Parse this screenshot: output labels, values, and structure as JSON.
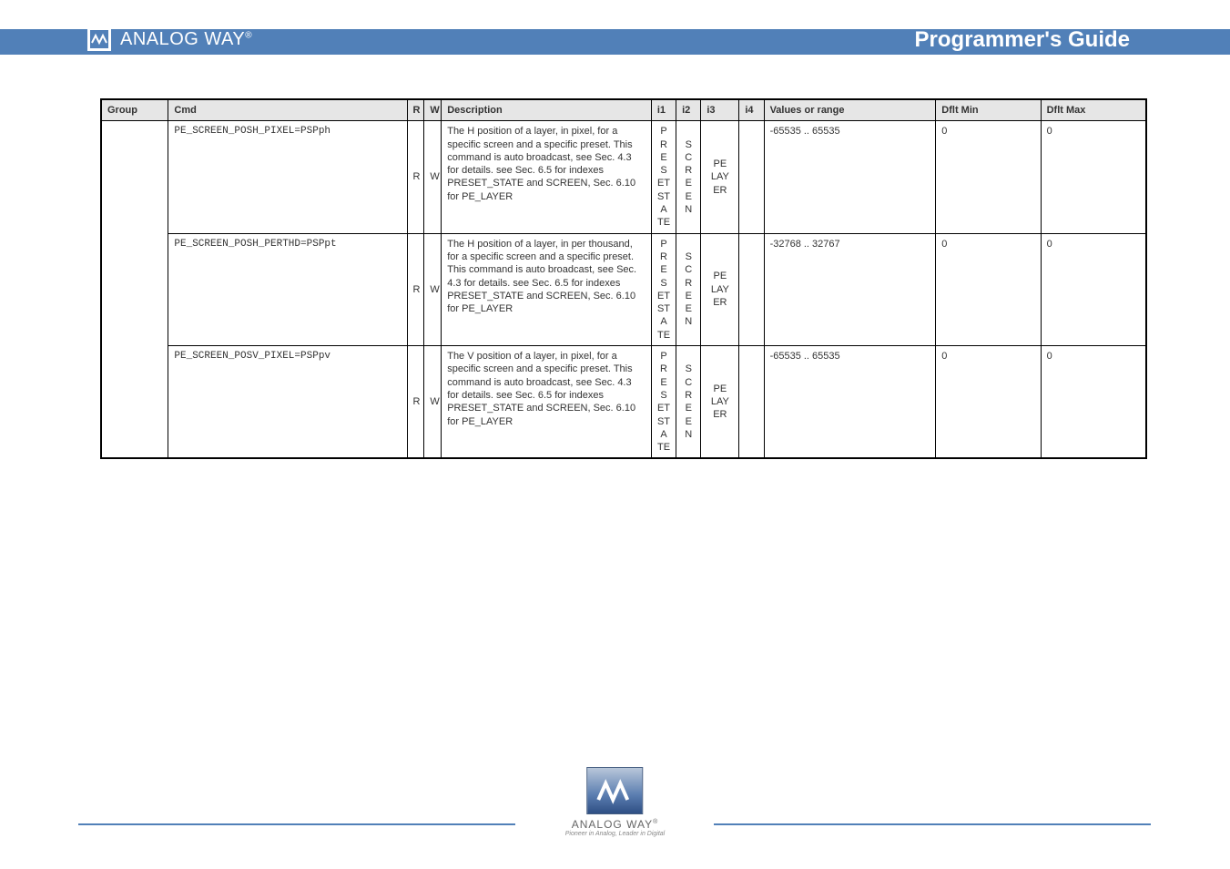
{
  "header": {
    "brand": "ANALOG WAY",
    "reg": "®",
    "title": "Programmer's Guide"
  },
  "table": {
    "headers": {
      "group": "Group",
      "cmd": "Cmd",
      "r": "R",
      "w": "W",
      "desc": "Description",
      "i1": "i1",
      "i2": "i2",
      "i3": "i3",
      "i4": "i4",
      "values": "Values or range",
      "min": "Dflt Min",
      "max": "Dflt Max"
    },
    "groupLabel": "",
    "rows": [
      {
        "cmd": "PE_SCREEN_POSH_PIXEL=PSPph",
        "r": "R",
        "w": "W",
        "desc": "The H position of a layer, in pixel, for a specific screen and a specific preset. This command is auto broadcast, see Sec. 4.3 for details. see Sec. 6.5 for indexes PRESET_STATE and SCREEN, Sec. 6.10 for PE_LAYER",
        "i1": "",
        "i2": "",
        "i3": "PE LAY ER",
        "i4": "",
        "values": "-65535 .. 65535",
        "min": "0",
        "max": "0"
      },
      {
        "cmd": "PE_SCREEN_POSH_PERTHD=PSPpt",
        "r": "R",
        "w": "W",
        "desc": "The H position of a layer, in per thousand, for a specific screen and a specific preset. This command is auto broadcast, see Sec. 4.3 for details. see Sec. 6.5 for indexes PRESET_STATE and SCREEN, Sec. 6.10 for PE_LAYER",
        "i1": "",
        "i2": "",
        "i3": "PE LAY ER",
        "i4": "",
        "values": "-32768 .. 32767",
        "min": "0",
        "max": "0"
      },
      {
        "cmd": "PE_SCREEN_POSV_PIXEL=PSPpv",
        "r": "R",
        "w": "W",
        "desc": "The V position of a layer, in pixel, for a specific screen and a specific preset. This command is auto broadcast, see Sec. 4.3 for details. see Sec. 6.5 for indexes PRESET_STATE and SCREEN, Sec. 6.10 for PE_LAYER",
        "i1": "",
        "i2": "",
        "i3": "PE LAY ER",
        "i4": "",
        "values": "-65535 .. 65535",
        "min": "0",
        "max": "0"
      }
    ],
    "commonIndexes": {
      "i1": "PRE SET STA TE",
      "i2": "SC REE N",
      "i4": ""
    }
  },
  "footer": {
    "brand": "ANALOG WAY",
    "reg": "®",
    "tagline": "Pioneer in Analog, Leader in Digital"
  }
}
